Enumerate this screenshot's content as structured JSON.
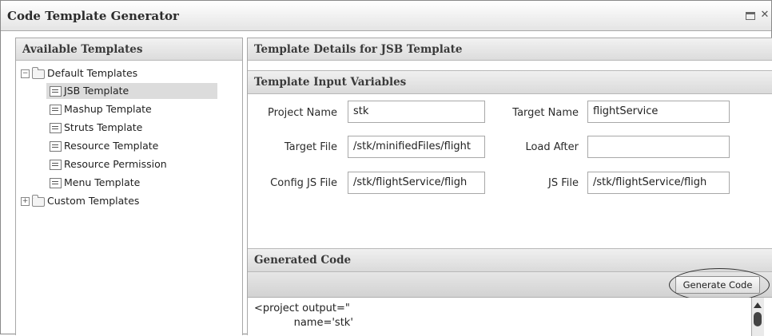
{
  "window": {
    "title": "Code Template Generator"
  },
  "left_panel": {
    "header": "Available Templates",
    "tree": [
      {
        "label": "Default Templates",
        "type": "folder",
        "expanded": true,
        "level": 0
      },
      {
        "label": "JSB Template",
        "type": "template",
        "selected": true,
        "level": 1
      },
      {
        "label": "Mashup Template",
        "type": "template",
        "level": 1
      },
      {
        "label": "Struts Template",
        "type": "template",
        "level": 1
      },
      {
        "label": "Resource Template",
        "type": "template",
        "level": 1
      },
      {
        "label": "Resource Permission",
        "type": "template",
        "level": 1
      },
      {
        "label": "Menu Template",
        "type": "template",
        "level": 1
      },
      {
        "label": "Custom Templates",
        "type": "folder",
        "expanded": false,
        "level": 0
      }
    ]
  },
  "right_panel": {
    "header": "Template Details for JSB Template",
    "input_section_title": "Template Input Variables",
    "fields": {
      "project_name": {
        "label": "Project Name",
        "value": "stk"
      },
      "target_name": {
        "label": "Target Name",
        "value": "flightService"
      },
      "target_file": {
        "label": "Target File",
        "value": "/stk/minifiedFiles/flight"
      },
      "load_after": {
        "label": "Load After",
        "value": ""
      },
      "config_js_file": {
        "label": "Config JS File",
        "value": "/stk/flightService/fligh"
      },
      "js_file": {
        "label": "JS File",
        "value": "/stk/flightService/fligh"
      }
    },
    "generated_section_title": "Generated Code",
    "generate_button_label": "Generate Code",
    "code_lines": [
      "<project output=\"",
      "            name='stk'"
    ]
  }
}
